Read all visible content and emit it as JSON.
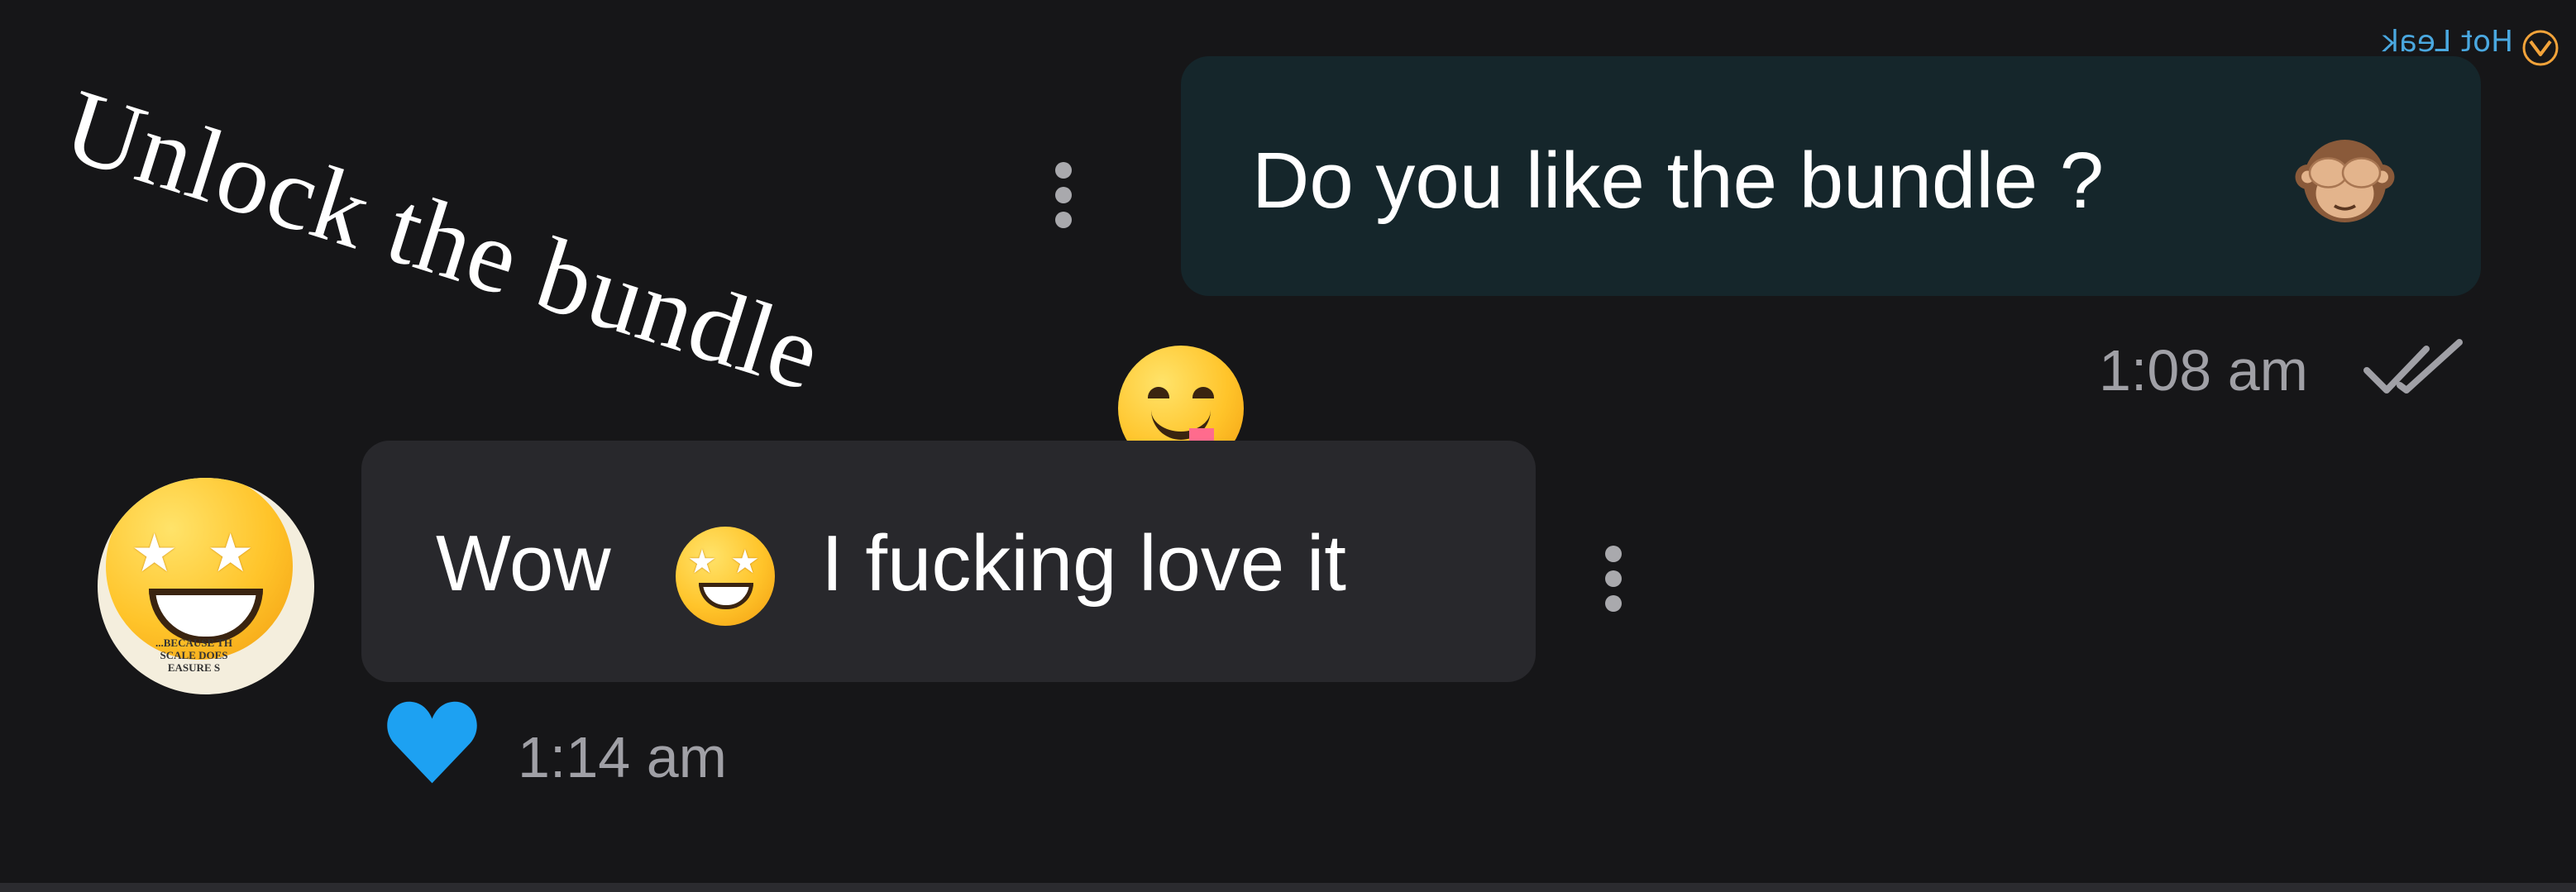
{
  "overlay": {
    "caption": "Unlock the bundle"
  },
  "messages": {
    "sent": {
      "text": "Do you like the bundle ?",
      "time": "1:08 am",
      "status_icon": "double-check-icon"
    },
    "received": {
      "text_start": "Wow",
      "text_end": "I fucking love it",
      "time": "1:14 am",
      "reaction_icon": "heart-icon",
      "avatar_caption_lines": [
        "...BECAUSE TH",
        "SCALE DOES",
        "EASURE S"
      ]
    }
  },
  "watermark": {
    "text": "Hot Leak"
  },
  "colors": {
    "background": "#161618",
    "sent_bubble": "#15262b",
    "received_bubble": "#28282c",
    "timestamp": "#a0a0a6",
    "heart": "#1da1f2"
  }
}
